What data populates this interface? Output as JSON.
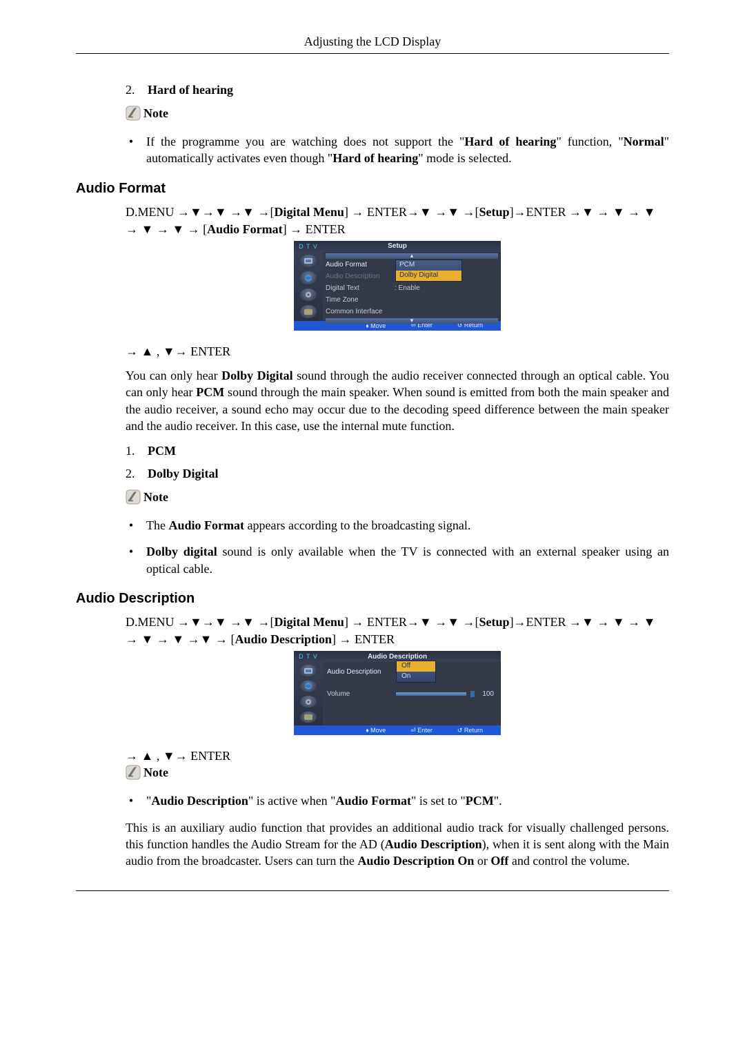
{
  "header": {
    "title": "Adjusting the LCD Display"
  },
  "hard_of_hearing": {
    "num": "2.",
    "label": "Hard of hearing",
    "note_label": "Note",
    "bullet_pre": "If the programme you are watching does not support the \"",
    "bullet_hoh": "Hard of hearing",
    "bullet_mid": "\" function, \"",
    "bullet_normal": "Normal",
    "bullet_post": "\" automatically activates even though \"",
    "bullet_hoh2": "Hard of hearing",
    "bullet_end": "\" mode is selected."
  },
  "audio_format": {
    "heading": "Audio Format",
    "nav_prefix": "D.MENU →▼→▼ →▼ →[",
    "nav_dm": "Digital Menu",
    "nav_mid1": "] → ENTER→▼ →▼ →[",
    "nav_setup": "Setup",
    "nav_mid2": "]→ENTER →▼ → ▼ → ▼ → ▼ → ▼ → [",
    "nav_af": "Audio Format",
    "nav_end": "] → ENTER",
    "osd": {
      "dtv": "D T V",
      "title": "Setup",
      "scroll_up": "▲",
      "items": {
        "audio_format": "Audio Format",
        "audio_description": "Audio Description",
        "digital_text": "Digital Text",
        "digital_text_val": ": Enable",
        "time_zone": "Time Zone",
        "common_interface": "Common Interface"
      },
      "scroll_down": "▼",
      "dropdown": {
        "pcm": "PCM",
        "dolby": "Dolby Digital"
      },
      "foot": {
        "move": "♦ Move",
        "enter": "⏎ Enter",
        "return": "↺ Return"
      }
    },
    "nav_select": "→ ▲ , ▼→ ENTER",
    "para_pre": "You can only hear ",
    "para_dd": "Dolby Digital",
    "para_mid1": " sound through the audio receiver connected through an optical cable. You can only hear ",
    "para_pcm": "PCM",
    "para_rest": " sound through the main speaker. When sound is emitted from both the main speaker and the audio receiver, a sound echo may occur due to the decoding speed difference between the main speaker and the audio receiver. In this case, use the internal mute function.",
    "list": {
      "one_num": "1.",
      "one": "PCM",
      "two_num": "2.",
      "two": "Dolby Digital"
    },
    "note_label": "Note",
    "note1_pre": "The ",
    "note1_af": "Audio Format",
    "note1_post": " appears according to the broadcasting signal.",
    "note2_dd": "Dolby digital",
    "note2_post": " sound is only available when the TV is connected with an external speaker using an optical cable."
  },
  "audio_description": {
    "heading": "Audio Description",
    "nav_prefix": "D.MENU →▼→▼ →▼ →[",
    "nav_dm": "Digital Menu",
    "nav_mid1": "] → ENTER→▼ →▼ →[",
    "nav_setup": "Setup",
    "nav_mid2": "]→ENTER →▼ → ▼ → ▼ → ▼ → ▼ →▼ → [",
    "nav_ad": "Audio Description",
    "nav_end": "] → ENTER",
    "osd": {
      "dtv": "D T V",
      "title": "Audio Description",
      "row1_label": "Audio Description",
      "dropdown": {
        "off": "Off",
        "on": "On"
      },
      "row2_label": "Volume",
      "volume_value": "100",
      "foot": {
        "move": "♦ Move",
        "enter": "⏎ Enter",
        "return": "↺ Return"
      }
    },
    "nav_select": "→ ▲ , ▼→ ENTER",
    "note_label": "Note",
    "note_bullet_pre": "\"",
    "note_bullet_ad": "Audio Description",
    "note_bullet_mid": "\" is active when \"",
    "note_bullet_af": "Audio Format",
    "note_bullet_mid2": "\" is set to \"",
    "note_bullet_pcm": "PCM",
    "note_bullet_end": "\".",
    "para_pre": "This is an auxiliary audio function that provides an additional audio track for visually challenged persons. this function handles the Audio Stream for the AD (",
    "para_ad": "Audio Description",
    "para_mid1": "), when it is sent along with the Main audio from the broadcaster. Users can turn the ",
    "para_adon": "Audio Description On",
    "para_mid2": " or ",
    "para_off": "Off",
    "para_end": " and control the volume."
  }
}
